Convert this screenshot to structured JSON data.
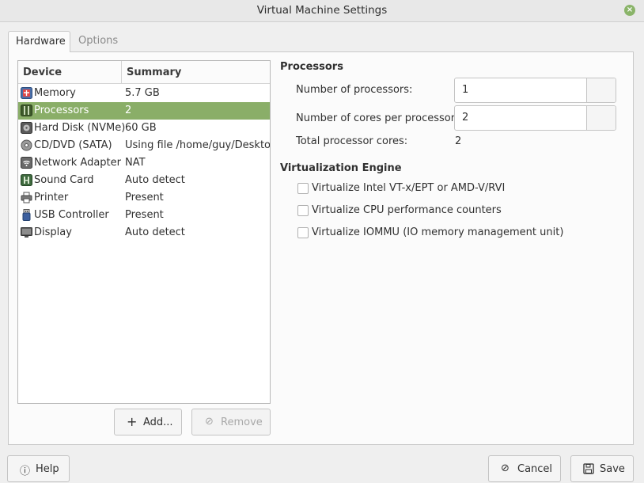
{
  "window": {
    "title": "Virtual Machine Settings",
    "close_glyph": "×"
  },
  "tabs": [
    {
      "label": "Hardware",
      "active": true
    },
    {
      "label": "Options",
      "active": false
    }
  ],
  "device_list": {
    "headers": {
      "device": "Device",
      "summary": "Summary"
    },
    "rows": [
      {
        "icon": "memory-icon",
        "name": "Memory",
        "summary": "5.7 GB",
        "selected": false
      },
      {
        "icon": "processor-icon",
        "name": "Processors",
        "summary": "2",
        "selected": true
      },
      {
        "icon": "hard-disk-icon",
        "name": "Hard Disk (NVMe)",
        "summary": "60 GB",
        "selected": false
      },
      {
        "icon": "cd-dvd-icon",
        "name": "CD/DVD (SATA)",
        "summary": "Using file /home/guy/Desktop",
        "selected": false
      },
      {
        "icon": "network-adapter-icon",
        "name": "Network Adapter",
        "summary": "NAT",
        "selected": false
      },
      {
        "icon": "sound-card-icon",
        "name": "Sound Card",
        "summary": "Auto detect",
        "selected": false
      },
      {
        "icon": "printer-icon",
        "name": "Printer",
        "summary": "Present",
        "selected": false
      },
      {
        "icon": "usb-controller-icon",
        "name": "USB Controller",
        "summary": "Present",
        "selected": false
      },
      {
        "icon": "display-icon",
        "name": "Display",
        "summary": "Auto detect",
        "selected": false
      }
    ]
  },
  "list_buttons": {
    "add": {
      "label": "Add...",
      "icon": "plus-icon",
      "glyph": "+"
    },
    "remove": {
      "label": "Remove",
      "icon": "remove-icon",
      "glyph": "⊘"
    }
  },
  "processors": {
    "section_title": "Processors",
    "num_processors_label": "Number of processors:",
    "num_processors_value": "1",
    "cores_label": "Number of cores per processor:",
    "cores_value": "2",
    "total_label": "Total processor cores:",
    "total_value": "2"
  },
  "virtualization": {
    "section_title": "Virtualization Engine",
    "options": [
      {
        "label": "Virtualize Intel VT-x/EPT or AMD-V/RVI",
        "checked": false
      },
      {
        "label": "Virtualize CPU performance counters",
        "checked": false
      },
      {
        "label": "Virtualize IOMMU (IO memory management unit)",
        "checked": false
      }
    ]
  },
  "footer": {
    "help": {
      "label": "Help",
      "icon": "info-icon",
      "glyph": "ⓘ"
    },
    "cancel": {
      "label": "Cancel",
      "icon": "cancel-icon",
      "glyph": "⊘"
    },
    "save": {
      "label": "Save",
      "icon": "save-icon"
    }
  },
  "colors": {
    "accent": "#8aae68",
    "close_button": "#8ab469"
  }
}
